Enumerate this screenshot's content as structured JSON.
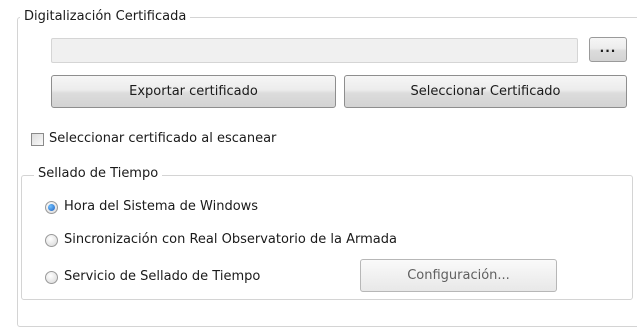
{
  "certificate_section": {
    "title": "Digitalización Certificada",
    "path_value": "",
    "browse_label": "...",
    "export_label": "Exportar  certificado",
    "select_label": "Seleccionar Certificado",
    "scan_checkbox": {
      "label": "Seleccionar certificado al escanear",
      "checked": false
    }
  },
  "timestamp_section": {
    "title": "Sellado de Tiempo",
    "options": [
      {
        "label": "Hora del Sistema de Windows",
        "selected": true
      },
      {
        "label": "Sincronización con Real Observatorio de la Armada",
        "selected": false
      },
      {
        "label": "Servicio de Sellado de Tiempo",
        "selected": false
      }
    ],
    "config_label": "Configuración...",
    "config_enabled": false
  }
}
